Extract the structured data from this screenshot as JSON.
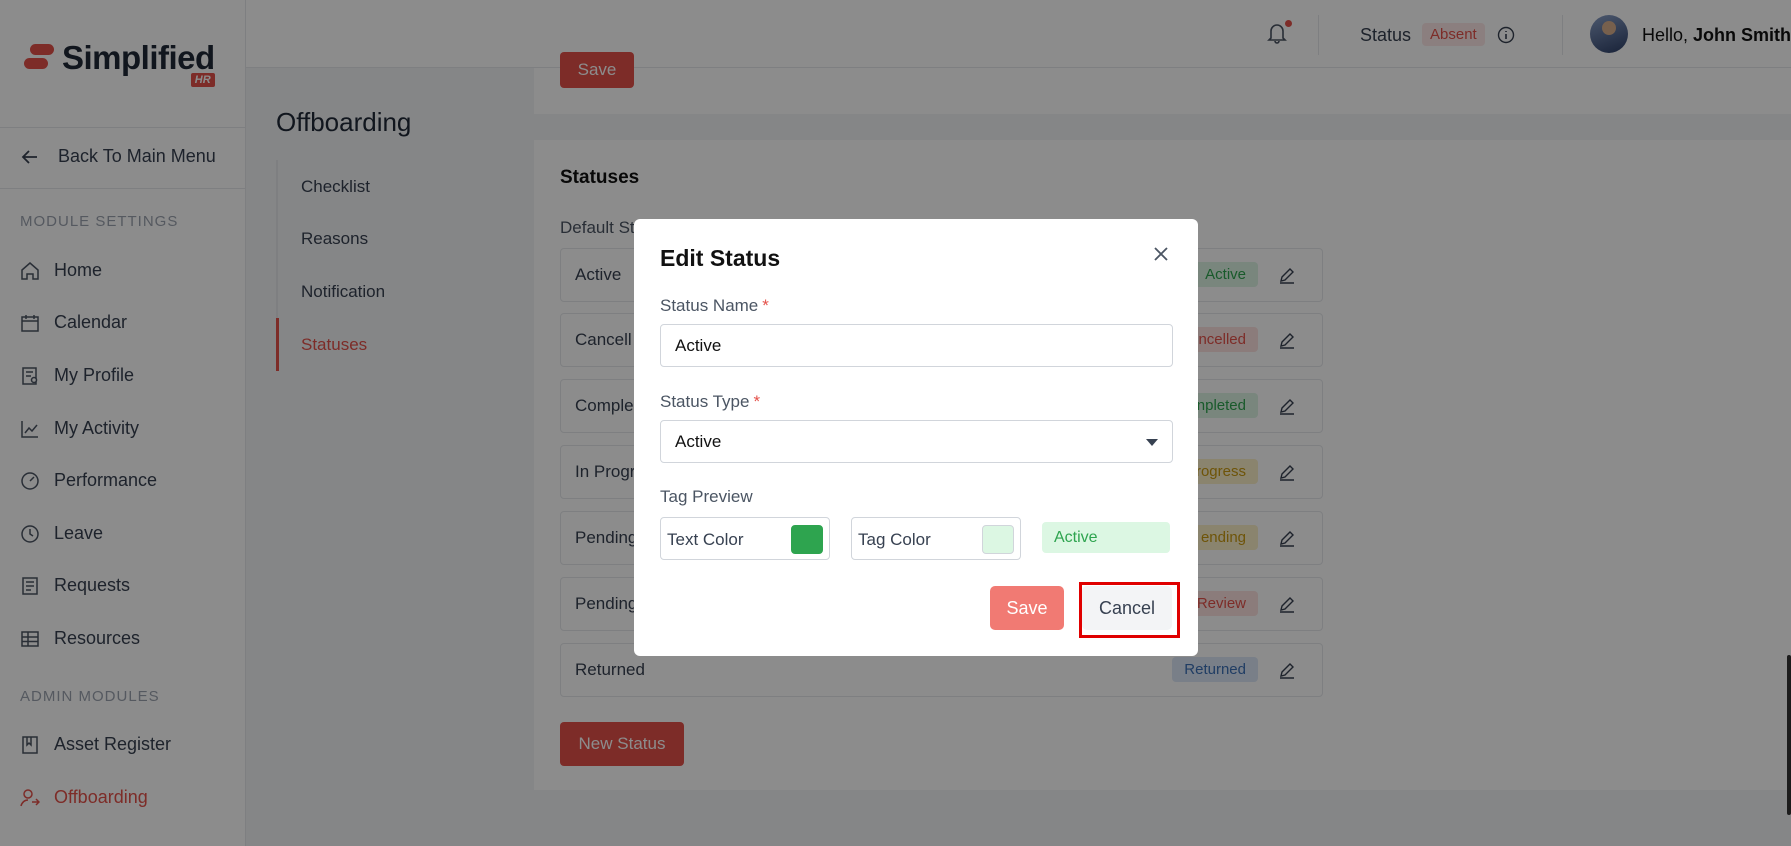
{
  "brand": {
    "name": "Simplified",
    "tag": "HR"
  },
  "sidebar": {
    "back": "Back To Main Menu",
    "module_settings_heading": "MODULE SETTINGS",
    "admin_modules_heading": "ADMIN MODULES",
    "items": [
      {
        "label": "Home",
        "icon": "home-icon"
      },
      {
        "label": "Calendar",
        "icon": "calendar-icon"
      },
      {
        "label": "My Profile",
        "icon": "profile-icon"
      },
      {
        "label": "My Activity",
        "icon": "activity-icon"
      },
      {
        "label": "Performance",
        "icon": "performance-icon"
      },
      {
        "label": "Leave",
        "icon": "clock-icon"
      },
      {
        "label": "Requests",
        "icon": "requests-icon"
      },
      {
        "label": "Resources",
        "icon": "grid-icon"
      }
    ],
    "admin_items": [
      {
        "label": "Asset Register",
        "icon": "book-icon"
      },
      {
        "label": "Offboarding",
        "icon": "offboarding-icon",
        "active": true
      }
    ]
  },
  "header": {
    "status_label": "Status",
    "status_value": "Absent",
    "greeting": "Hello,",
    "user_name": "John Smith"
  },
  "page": {
    "title": "Offboarding",
    "subnav": [
      "Checklist",
      "Reasons",
      "Notification",
      "Statuses"
    ],
    "active_subnav": "Statuses",
    "top_save": "Save"
  },
  "statuses": {
    "heading": "Statuses",
    "default_label": "Default St",
    "rows": [
      {
        "name": "Active",
        "tag": "Active",
        "tag_text": "#2ea44f",
        "tag_bg": "#dcf5e3"
      },
      {
        "name": "Cancell",
        "tag": "ncelled",
        "tag_text": "#e4514a",
        "tag_bg": "#fde2e0"
      },
      {
        "name": "Comple",
        "tag": "npleted",
        "tag_text": "#2ea44f",
        "tag_bg": "#dcf5e3"
      },
      {
        "name": "In Progr",
        "tag": "rogress",
        "tag_text": "#c99a10",
        "tag_bg": "#fcf0c9"
      },
      {
        "name": "Pending",
        "tag": "ending",
        "tag_text": "#c99a10",
        "tag_bg": "#fcf0c9"
      },
      {
        "name": "Pending",
        "tag": "Review",
        "tag_text": "#e4514a",
        "tag_bg": "#fde2e0"
      },
      {
        "name": "Returned",
        "tag": "Returned",
        "tag_text": "#3b6fb6",
        "tag_bg": "#dde8f7"
      }
    ],
    "new_button": "New Status"
  },
  "modal": {
    "title": "Edit Status",
    "name_label": "Status Name",
    "name_value": "Active",
    "type_label": "Status Type",
    "type_value": "Active",
    "required_mark": "*",
    "preview_label": "Tag Preview",
    "text_color_label": "Text Color",
    "text_color": "#2ea44f",
    "tag_color_label": "Tag Color",
    "tag_color": "#dcf7e3",
    "preview_text": "Active",
    "save": "Save",
    "cancel": "Cancel"
  },
  "colors": {
    "accent": "#e4514a"
  }
}
